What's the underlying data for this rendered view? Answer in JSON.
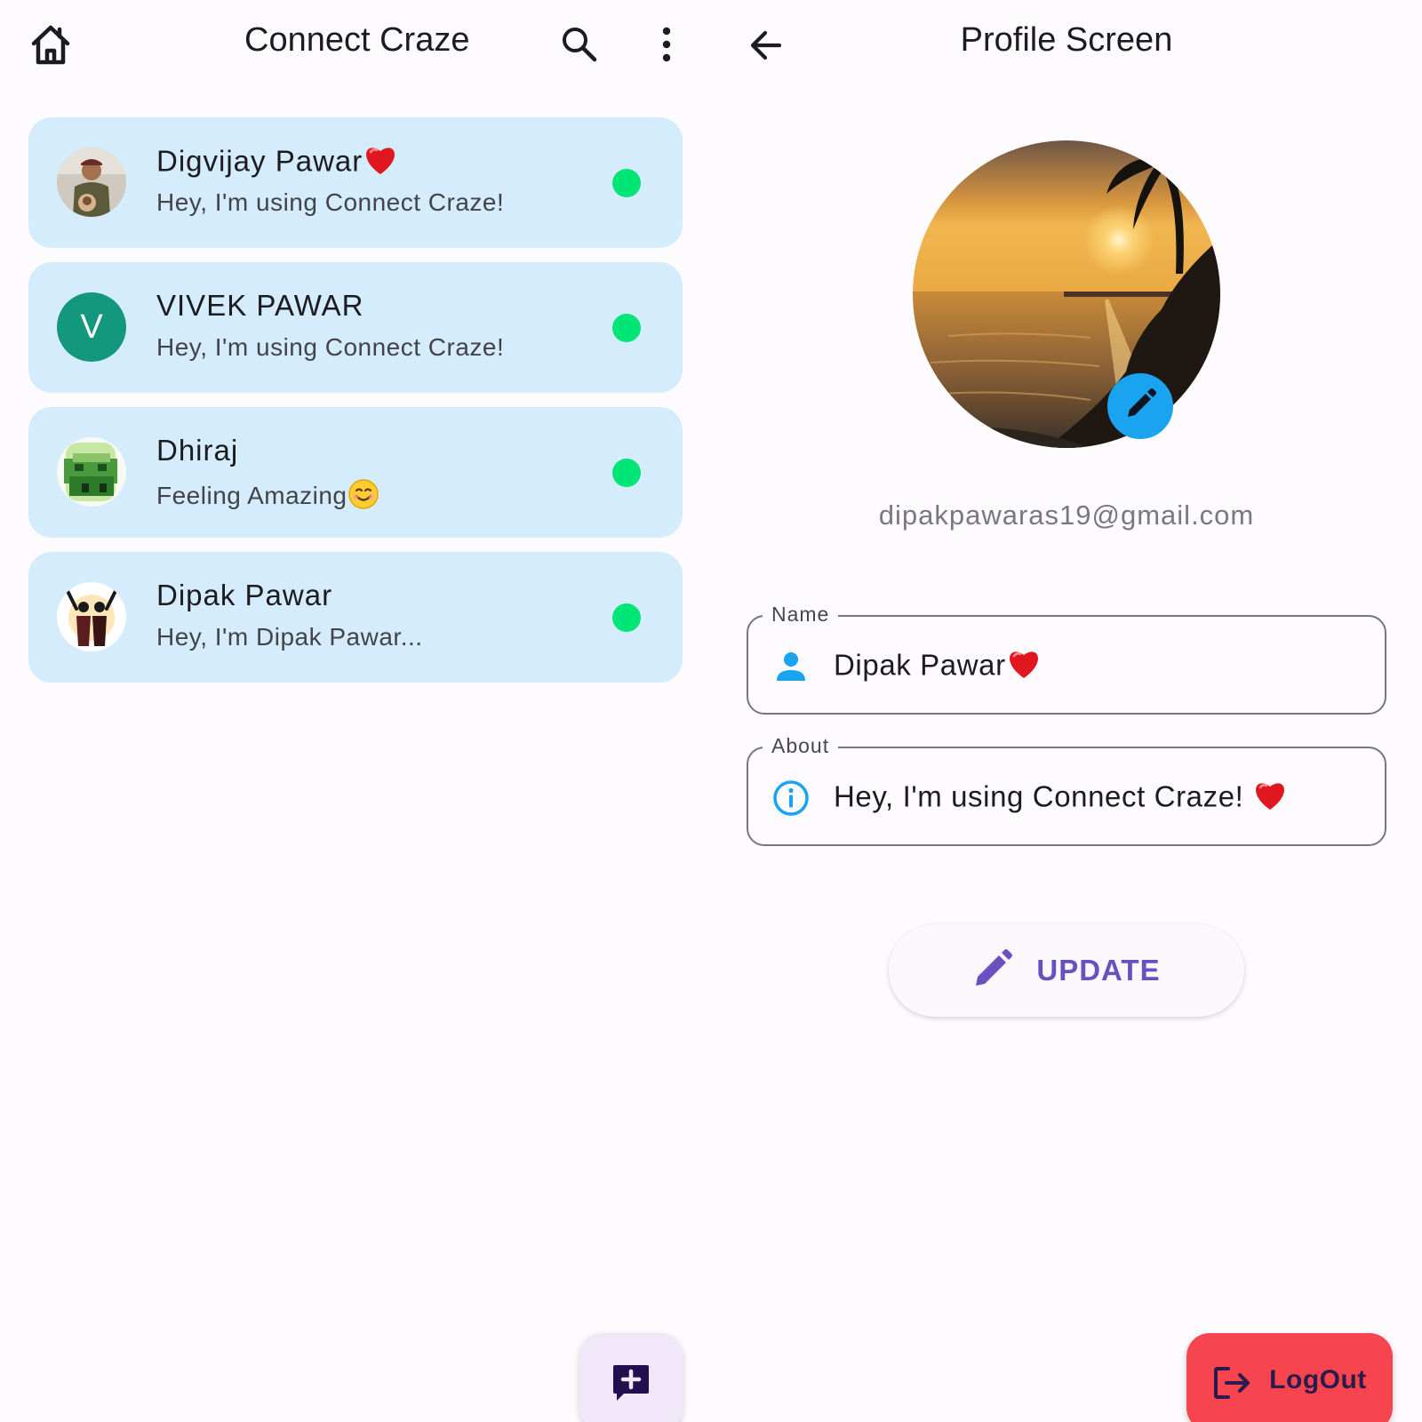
{
  "home": {
    "app_title": "Connect Craze",
    "icons": [
      "home-icon",
      "search-icon",
      "more-vert-icon"
    ],
    "chats": [
      {
        "name": "Digvijay Pawar",
        "name_emoji": "❤️",
        "about": "Hey, I'm using Connect Craze!",
        "avatar": "photo",
        "online": true
      },
      {
        "name": "VIVEK PAWAR",
        "about": "Hey, I'm using Connect Craze!",
        "avatar_letter": "V",
        "online": true
      },
      {
        "name": "Dhiraj",
        "about": "Feeling Amazing",
        "about_emoji": "😊",
        "avatar": "photo",
        "online": true
      },
      {
        "name": "Dipak Pawar",
        "about": "Hey, I'm Dipak Pawar...",
        "avatar": "photo",
        "online": true
      }
    ],
    "fab_icon": "add-comment-icon"
  },
  "profile": {
    "title": "Profile Screen",
    "back_icon": "arrow-back-icon",
    "email": "dipakpawaras19@gmail.com",
    "name_field": {
      "label": "Name",
      "value": "Dipak Pawar",
      "emoji": "❤️",
      "icon": "person-icon"
    },
    "about_field": {
      "label": "About",
      "value": "Hey, I'm using Connect Craze! ",
      "emoji": "❤️",
      "icon": "info-icon"
    },
    "update_label": "UPDATE",
    "logout_label": "LogOut"
  },
  "colors": {
    "card_bg": "#d4ecfb",
    "online": "#00e676",
    "accent_blue": "#1aa3ee",
    "update_purple": "#6a4fbf",
    "logout_red": "#f7454f",
    "avatar_teal": "#13977d"
  }
}
